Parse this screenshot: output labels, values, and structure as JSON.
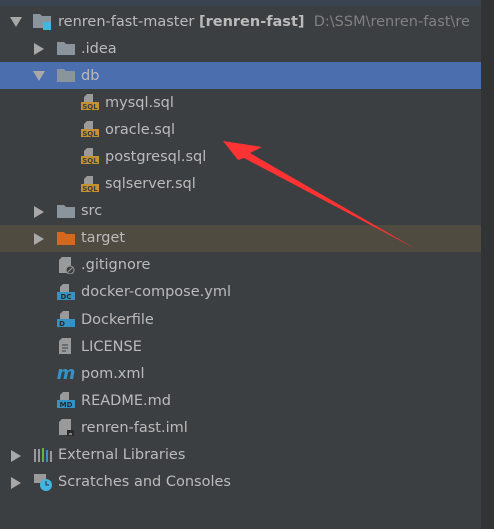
{
  "tree": {
    "root": {
      "name": "renren-fast-master",
      "module": "[renren-fast]",
      "path": "D:\\SSM\\renren-fast\\re"
    },
    "items": [
      {
        "label": ".idea",
        "icon": "folder-icon"
      },
      {
        "label": "db",
        "icon": "folder-icon",
        "selected": true
      },
      {
        "label": "mysql.sql",
        "icon": "sql-file-icon"
      },
      {
        "label": "oracle.sql",
        "icon": "sql-file-icon"
      },
      {
        "label": "postgresql.sql",
        "icon": "sql-file-icon"
      },
      {
        "label": "sqlserver.sql",
        "icon": "sql-file-icon"
      },
      {
        "label": "src",
        "icon": "folder-icon"
      },
      {
        "label": "target",
        "icon": "excluded-folder-icon"
      },
      {
        "label": ".gitignore",
        "icon": "gitignore-file-icon"
      },
      {
        "label": "docker-compose.yml",
        "icon": "docker-compose-file-icon"
      },
      {
        "label": "Dockerfile",
        "icon": "dockerfile-icon"
      },
      {
        "label": "LICENSE",
        "icon": "text-file-icon"
      },
      {
        "label": "pom.xml",
        "icon": "maven-icon"
      },
      {
        "label": "README.md",
        "icon": "markdown-file-icon"
      },
      {
        "label": "renren-fast.iml",
        "icon": "iml-file-icon"
      },
      {
        "label": "External Libraries",
        "icon": "libraries-icon"
      },
      {
        "label": "Scratches and Consoles",
        "icon": "scratches-icon"
      }
    ]
  },
  "colors": {
    "selection": "#4b6eaf",
    "excluded": "#4f4b41",
    "annotation_arrow": "#ff3333"
  },
  "sql_badge": "SQL",
  "md_badge": "MD",
  "dc_badge": "DC",
  "d_badge": "D"
}
